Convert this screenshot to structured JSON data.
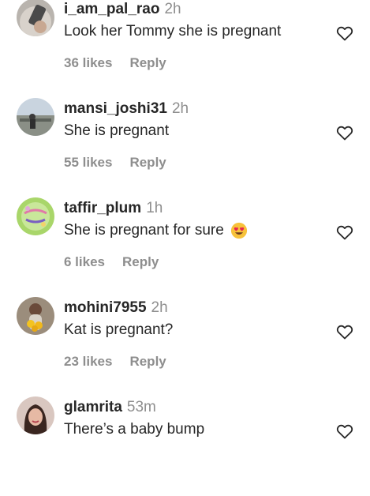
{
  "comments": [
    {
      "username": "i_am_pal_rao",
      "time": "2h",
      "text": "Look her Tommy she is pregnant",
      "likes": "36 likes",
      "reply": "Reply"
    },
    {
      "username": "mansi_joshi31",
      "time": "2h",
      "text": "She is pregnant",
      "likes": "55 likes",
      "reply": "Reply"
    },
    {
      "username": "taffir_plum",
      "time": "1h",
      "text": "She is pregnant for sure",
      "emoji": "heart-eyes-emoji",
      "likes": "6 likes",
      "reply": "Reply"
    },
    {
      "username": "mohini7955",
      "time": "2h",
      "text": "Kat is pregnant?",
      "likes": "23 likes",
      "reply": "Reply"
    },
    {
      "username": "glamrita",
      "time": "53m",
      "text": "There’s a baby bump"
    }
  ],
  "icons": {
    "like": "heart-outline-icon"
  },
  "colors": {
    "text": "#262626",
    "secondary": "#8e8e8e"
  }
}
